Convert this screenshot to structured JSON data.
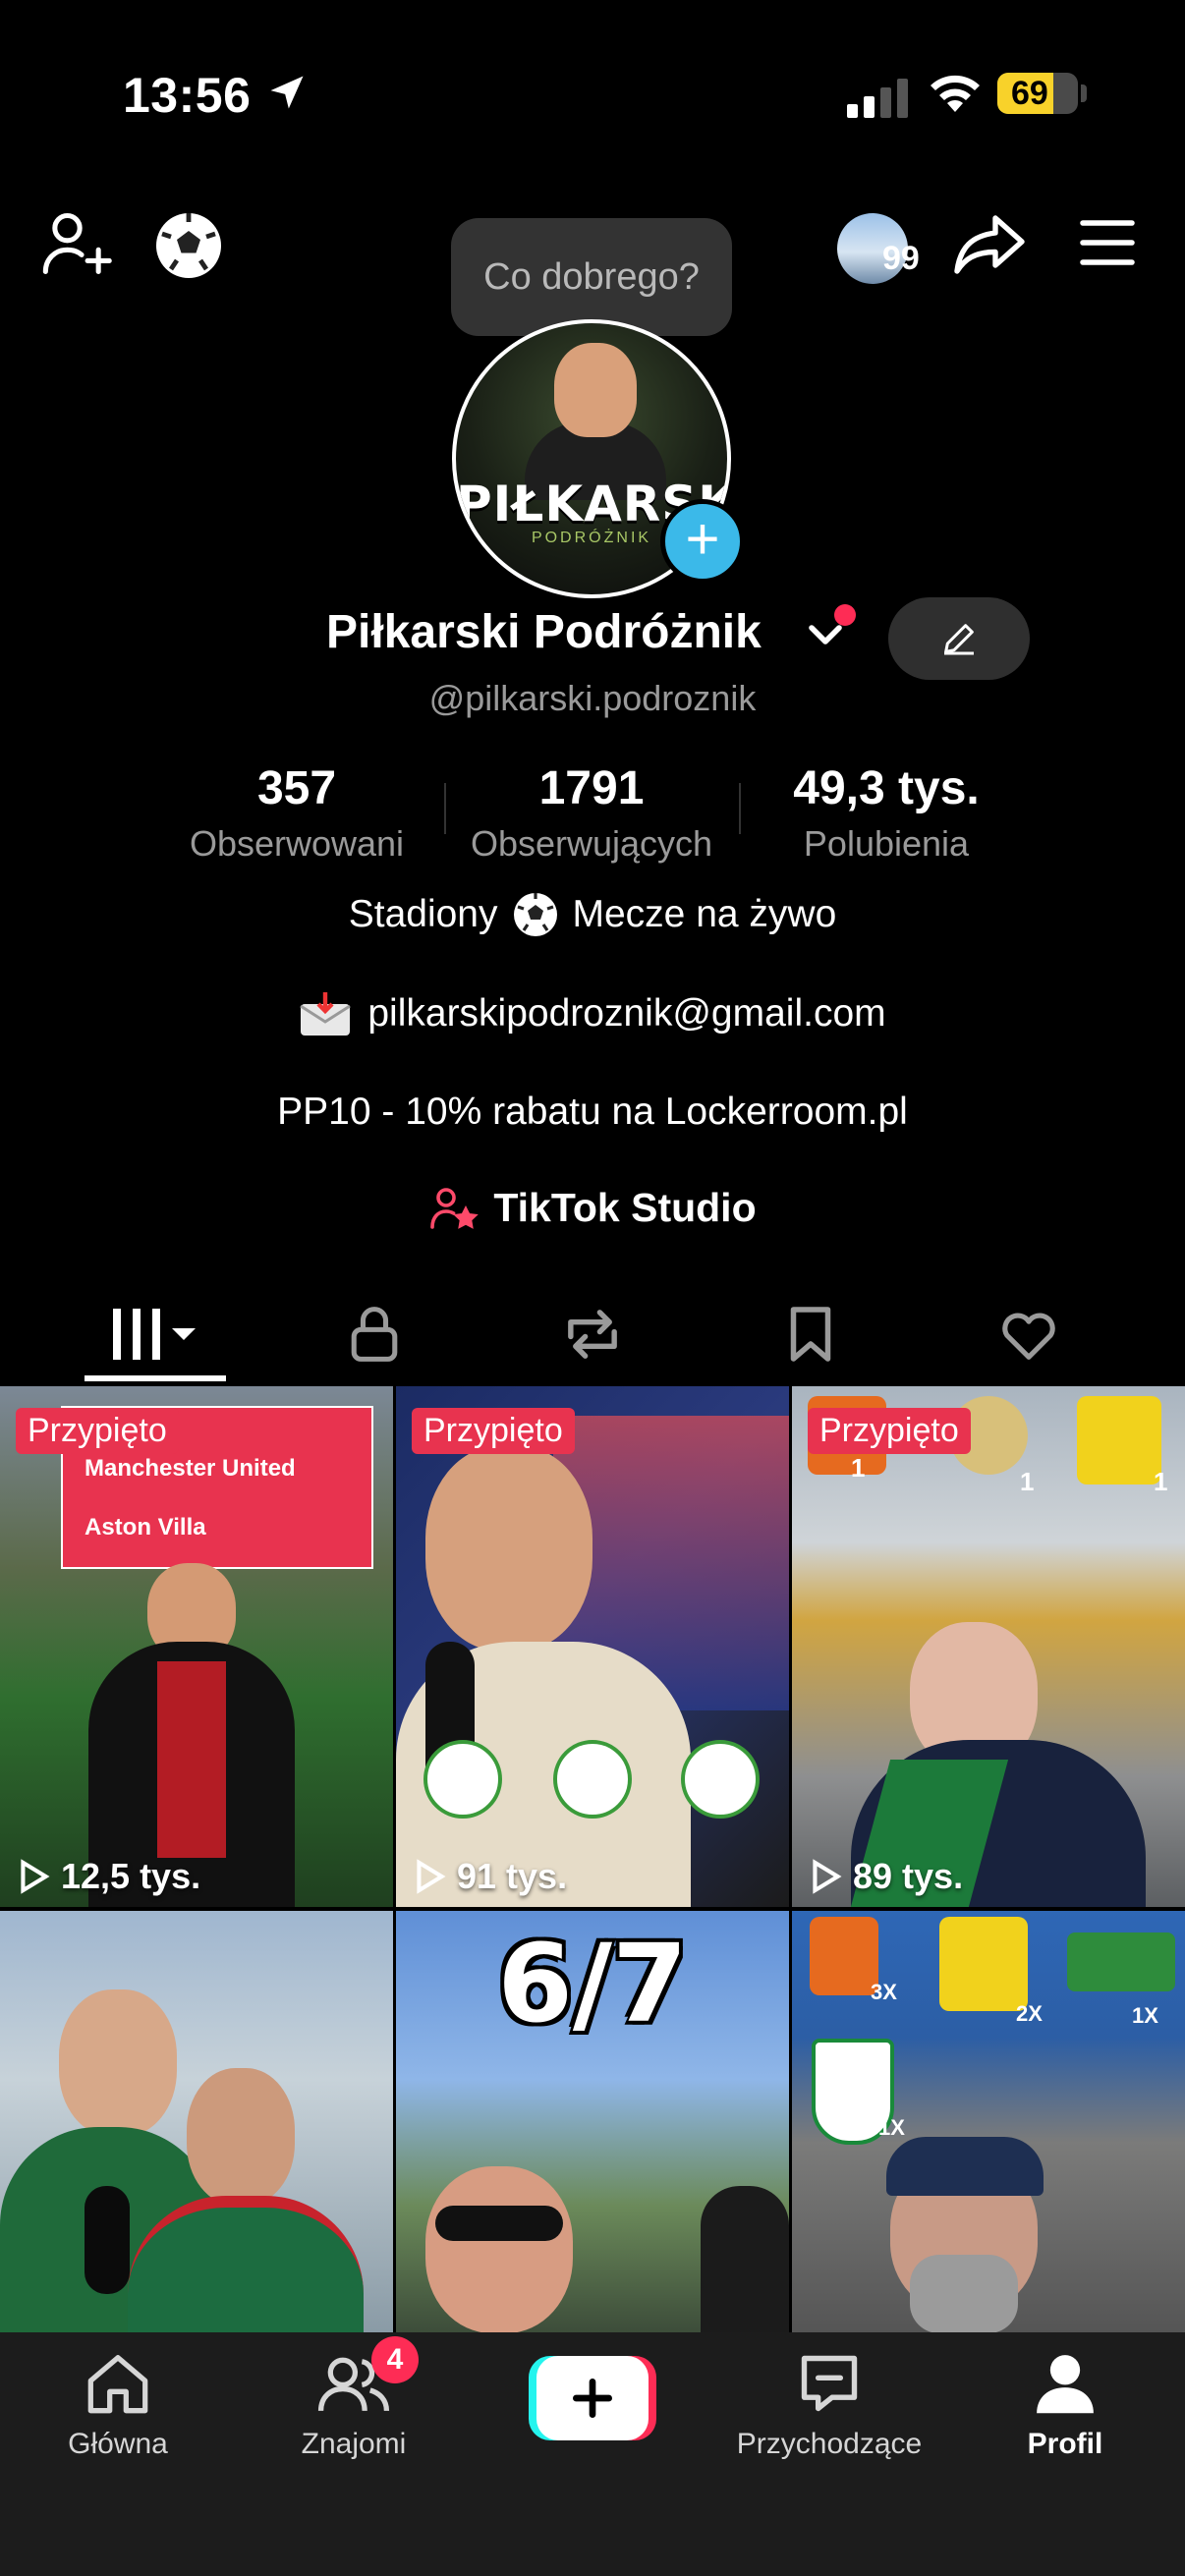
{
  "status_bar": {
    "time": "13:56",
    "battery": "69"
  },
  "top": {
    "tooltip": "Co dobrego?",
    "friends_count": "99"
  },
  "profile": {
    "avatar_logo": "PIŁKARSKI",
    "avatar_sub": "PODRÓŻNIK",
    "name": "Piłkarski Podróżnik",
    "handle": "@pilkarski.podroznik"
  },
  "stats": [
    {
      "value": "357",
      "label": "Obserwowani"
    },
    {
      "value": "1791",
      "label": "Obserwujących"
    },
    {
      "value": "49,3 tys.",
      "label": "Polubienia"
    }
  ],
  "bio": {
    "line1_a": "Stadiony",
    "line1_b": "Mecze na żywo",
    "email": "pilkarskipodroznik@gmail.com",
    "promo": "PP10 - 10% rabatu na Lockerroom.pl",
    "studio": "TikTok Studio"
  },
  "videos": [
    {
      "pinned": "Przypięto",
      "views": "12,5 tys.",
      "overlay": [
        "Manchester United",
        "Aston Villa"
      ]
    },
    {
      "pinned": "Przypięto",
      "views": "91 tys.",
      "overlay": []
    },
    {
      "pinned": "Przypięto",
      "views": "89 tys.",
      "overlay": [
        "1",
        "1",
        "1"
      ]
    },
    {
      "pinned": "",
      "views": "",
      "overlay": []
    },
    {
      "pinned": "",
      "views": "",
      "overlay": [
        "6/7"
      ]
    },
    {
      "pinned": "",
      "views": "",
      "overlay": [
        "3X",
        "2X",
        "1X",
        "1X"
      ]
    }
  ],
  "nav": {
    "home": "Główna",
    "friends": "Znajomi",
    "friends_badge": "4",
    "inbox": "Przychodzące",
    "profile": "Profil"
  }
}
